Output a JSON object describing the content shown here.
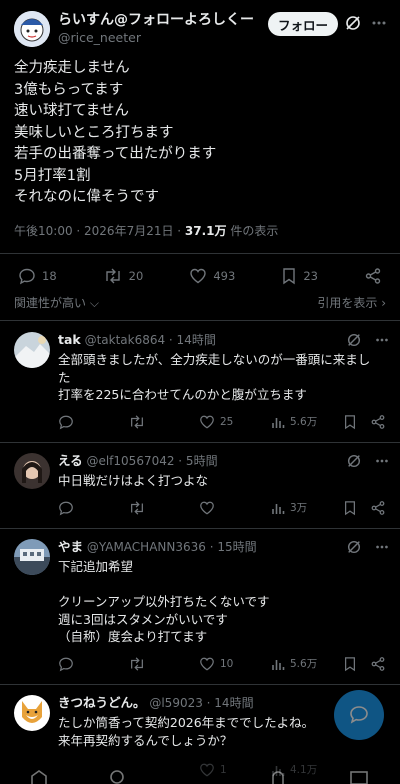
{
  "main_post": {
    "display_name": "らいすん@フォローよろしくー",
    "handle": "@rice_neeter",
    "follow_label": "フォロー",
    "text_lines": [
      "全力疾走しません",
      "3億もらってます",
      "速い球打てません",
      "美味しいところ打ちます",
      "若手の出番奪って出たがります",
      "5月打率1割",
      "それなのに偉そうです"
    ],
    "timestamp": "午後10:00 · 2026年7月21日 · ",
    "views": "37.1万",
    "views_label": " 件の表示",
    "stats": {
      "replies": "18",
      "retweets": "20",
      "likes": "493",
      "bookmarks": "23"
    },
    "sort_label": "関連性が高い",
    "quotes_label": "引用を表示"
  },
  "replies": [
    {
      "name": "tak",
      "handle": "@taktak6864 · 14時間",
      "lines": [
        "全部頭きましたが、全力疾走しないのが一番頭に来まし",
        "た",
        "打率を225に合わせてんのかと腹が立ちます"
      ],
      "replies": "",
      "retweets": "",
      "likes": "25",
      "views": "5.6万"
    },
    {
      "name": "える",
      "handle": "@elf10567042 · 5時間",
      "lines": [
        "中日戦だけはよく打つよな"
      ],
      "replies": "",
      "retweets": "",
      "likes": "",
      "views": "3万"
    },
    {
      "name": "やま",
      "handle": "@YAMACHANN3636 · 15時間",
      "lines": [
        "下記追加希望",
        "",
        "クリーンアップ以外打ちたくないです",
        "週に3回はスタメンがいいです",
        "（自称）度会より打てます"
      ],
      "replies": "",
      "retweets": "",
      "likes": "10",
      "views": "5.6万"
    },
    {
      "name": "きつねうどん。",
      "handle": "@l59023 · 14時間",
      "lines": [
        "たしか筒香って契約2026年まででしたよね。",
        "来年再契約するんでしょうか？"
      ],
      "replies": "",
      "retweets": "",
      "likes": "1",
      "views": "4.1万"
    }
  ],
  "colors": {
    "accent": "#1d9bf0",
    "muted": "#71767b",
    "text": "#e7e9ea",
    "divider": "#2f3336"
  }
}
